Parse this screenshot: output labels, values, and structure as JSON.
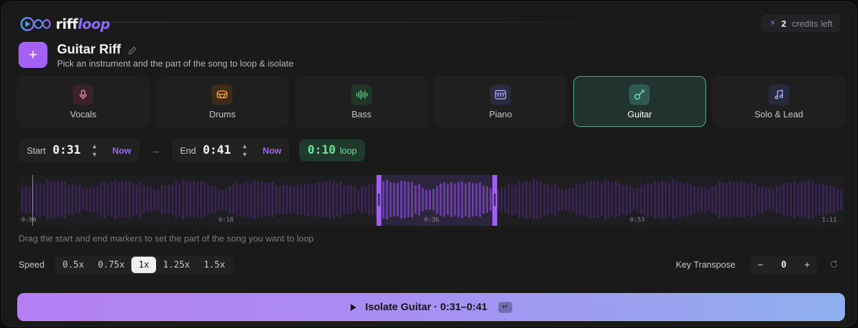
{
  "brand": {
    "name_part1": "riff",
    "name_part2": "loop"
  },
  "credits": {
    "count": "2",
    "label": "credits left"
  },
  "project": {
    "title": "Guitar Riff",
    "subtitle": "Pick an instrument and the part of the song to loop & isolate",
    "add_label": "+"
  },
  "instruments": [
    {
      "label": "Vocals",
      "icon": "microphone-icon",
      "active": false,
      "color": "#f08fa8",
      "bg": "#3a2328"
    },
    {
      "label": "Drums",
      "icon": "drum-icon",
      "active": false,
      "color": "#f0a040",
      "bg": "#3d2c18"
    },
    {
      "label": "Bass",
      "icon": "soundwave-icon",
      "active": false,
      "color": "#55d08a",
      "bg": "#1f3526"
    },
    {
      "label": "Piano",
      "icon": "piano-icon",
      "active": false,
      "color": "#a9a4f5",
      "bg": "#2a2a40"
    },
    {
      "label": "Guitar",
      "icon": "guitar-icon",
      "active": true,
      "color": "#7fe0c0",
      "bg": "#2e5a50"
    },
    {
      "label": "Solo & Lead",
      "icon": "music-note-icon",
      "active": false,
      "color": "#a8b6f5",
      "bg": "#262a3c"
    }
  ],
  "range": {
    "start_label": "Start",
    "start_value": "0:31",
    "end_label": "End",
    "end_value": "0:41",
    "now_label": "Now",
    "arrow": "→",
    "loop_value": "0:10",
    "loop_label": "loop"
  },
  "waveform": {
    "ticks": [
      "0:00",
      "0:18",
      "0:36",
      "0:53",
      "1:11"
    ],
    "duration_seconds": 71,
    "selection_start_seconds": 31,
    "selection_end_seconds": 41,
    "playhead_seconds": 0,
    "bar_color": "#3a2456",
    "selected_bar_color": "#6a3fa8",
    "handle_color": "#a060f0"
  },
  "help_text": "Drag the start and end markers to set the part of the song you want to loop",
  "speed": {
    "label": "Speed",
    "options": [
      "0.5x",
      "0.75x",
      "1x",
      "1.25x",
      "1.5x"
    ],
    "selected": "1x"
  },
  "key": {
    "label": "Key Transpose",
    "minus": "−",
    "plus": "+",
    "value": "0"
  },
  "cta": {
    "label": "Isolate Guitar · 0:31–0:41",
    "kbd": "↵"
  },
  "colors": {
    "accent": "#a560f5",
    "loop_green": "#6ee09a"
  }
}
